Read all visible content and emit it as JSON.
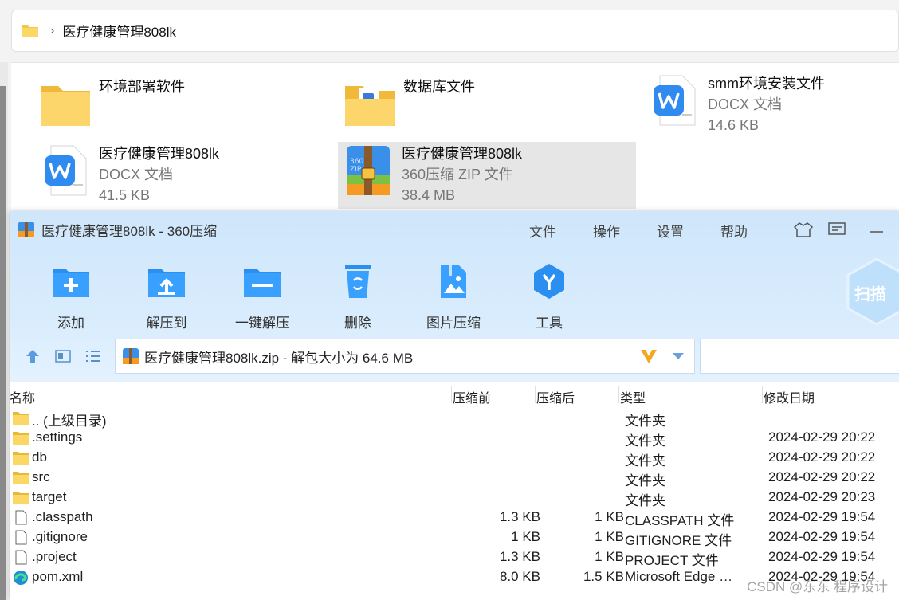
{
  "explorer": {
    "breadcrumb": "医疗健康管理808lk",
    "tiles": [
      {
        "name": "环境部署软件",
        "lines": [],
        "icon": "folder-icon"
      },
      {
        "name": "数据库文件",
        "lines": [],
        "icon": "folder-with-doc-icon"
      },
      {
        "name": "smm环境安装文件",
        "lines": [
          "DOCX 文档",
          "14.6 KB"
        ],
        "icon": "wps-doc-icon"
      },
      {
        "name": "医疗健康管理808lk",
        "lines": [
          "DOCX 文档",
          "41.5 KB"
        ],
        "icon": "wps-doc-icon"
      },
      {
        "name": "医疗健康管理808lk",
        "lines": [
          "360压缩 ZIP 文件",
          "38.4 MB"
        ],
        "icon": "zip-archive-icon"
      }
    ]
  },
  "zip": {
    "title": "医疗健康管理808lk - 360压缩",
    "menu": [
      "文件",
      "操作",
      "设置",
      "帮助"
    ],
    "toolbar": [
      "添加",
      "解压到",
      "一键解压",
      "删除",
      "图片压缩",
      "工具"
    ],
    "scan_label": "扫描",
    "path_text": "医疗健康管理808lk.zip - 解包大小为 64.6 MB",
    "columns": [
      "名称",
      "压缩前",
      "压缩后",
      "类型",
      "修改日期"
    ],
    "rows": [
      {
        "name": ".. (上级目录)",
        "packed": "",
        "unpacked": "",
        "type": "文件夹",
        "date": "",
        "kind": "folder"
      },
      {
        "name": ".settings",
        "packed": "",
        "unpacked": "",
        "type": "文件夹",
        "date": "2024-02-29 20:22",
        "kind": "folder"
      },
      {
        "name": "db",
        "packed": "",
        "unpacked": "",
        "type": "文件夹",
        "date": "2024-02-29 20:22",
        "kind": "folder"
      },
      {
        "name": "src",
        "packed": "",
        "unpacked": "",
        "type": "文件夹",
        "date": "2024-02-29 20:22",
        "kind": "folder"
      },
      {
        "name": "target",
        "packed": "",
        "unpacked": "",
        "type": "文件夹",
        "date": "2024-02-29 20:23",
        "kind": "folder"
      },
      {
        "name": ".classpath",
        "packed": "1.3 KB",
        "unpacked": "1 KB",
        "type": "CLASSPATH 文件",
        "date": "2024-02-29 19:54",
        "kind": "file"
      },
      {
        "name": ".gitignore",
        "packed": "1 KB",
        "unpacked": "1 KB",
        "type": "GITIGNORE 文件",
        "date": "2024-02-29 19:54",
        "kind": "file"
      },
      {
        "name": ".project",
        "packed": "1.3 KB",
        "unpacked": "1 KB",
        "type": "PROJECT 文件",
        "date": "2024-02-29 19:54",
        "kind": "file"
      },
      {
        "name": "pom.xml",
        "packed": "8.0 KB",
        "unpacked": "1.5 KB",
        "type": "Microsoft Edge HT...",
        "date": "2024-02-29 19:54",
        "kind": "edge"
      }
    ]
  },
  "watermark": "CSDN @东东 程序设计"
}
